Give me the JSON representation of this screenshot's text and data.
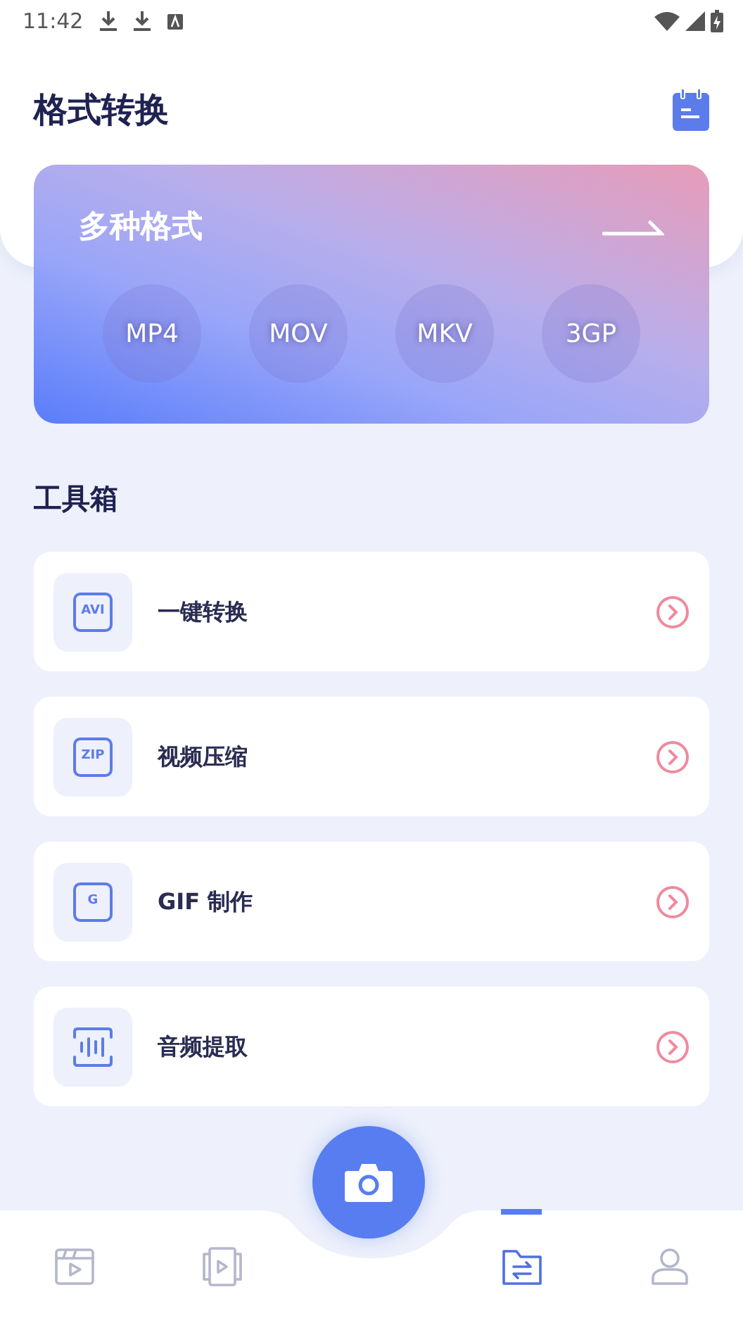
{
  "status_bar": {
    "time": "11:42"
  },
  "header": {
    "title": "格式转换"
  },
  "banner": {
    "title": "多种格式",
    "formats": [
      "MP4",
      "MOV",
      "MKV",
      "3GP"
    ]
  },
  "toolbox": {
    "title": "工具箱",
    "items": [
      {
        "kind": "badge",
        "icon_text": "AVI",
        "label": "一键转换"
      },
      {
        "kind": "badge",
        "icon_text": "ZIP",
        "label": "视频压缩"
      },
      {
        "kind": "badge",
        "icon_text": "G",
        "label": "GIF 制作"
      },
      {
        "kind": "audio",
        "label": "音频提取"
      }
    ]
  },
  "bottom_nav": {
    "tabs": [
      {
        "kind": "clapper",
        "selected": false
      },
      {
        "kind": "slides",
        "selected": false
      },
      {
        "kind": "folder",
        "selected": true
      },
      {
        "kind": "person",
        "selected": false
      }
    ]
  }
}
